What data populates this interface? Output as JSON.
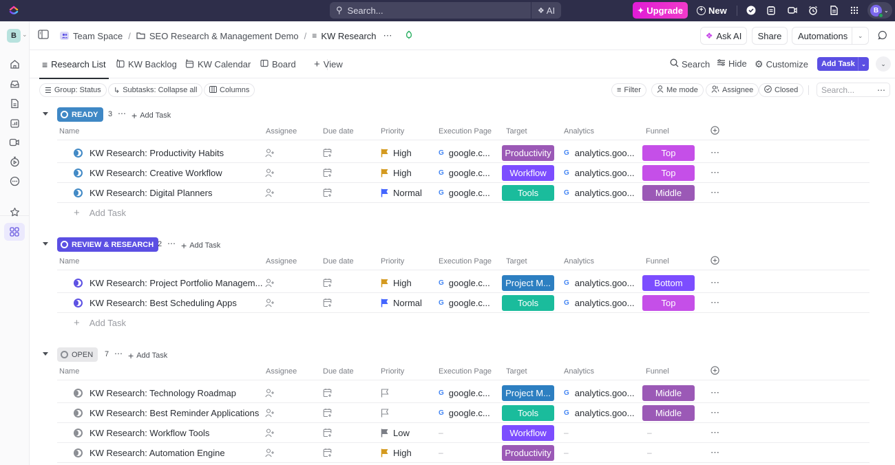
{
  "topbar": {
    "search_placeholder": "Search...",
    "ai_label": "AI",
    "upgrade_label": "Upgrade",
    "new_label": "New",
    "avatar_initial": "B"
  },
  "sidebar": {
    "workspace_initial": "B",
    "items": [
      "home",
      "inbox",
      "docs",
      "dashboards",
      "clips",
      "timesheets",
      "more",
      "favorites",
      "spaces"
    ]
  },
  "header": {
    "breadcrumbs": [
      "Team Space",
      "SEO Research & Management Demo",
      "KW Research"
    ],
    "ask_ai_label": "Ask AI",
    "share_label": "Share",
    "automations_label": "Automations"
  },
  "tabs": {
    "items": [
      "Research List",
      "KW Backlog",
      "KW Calendar",
      "Board"
    ],
    "add_view_label": "View",
    "search_label": "Search",
    "hide_label": "Hide",
    "customize_label": "Customize",
    "add_task_label": "Add Task"
  },
  "filters": {
    "group_label": "Group: Status",
    "subtasks_label": "Subtasks: Collapse all",
    "columns_label": "Columns",
    "filter_label": "Filter",
    "me_mode_label": "Me mode",
    "assignee_label": "Assignee",
    "closed_label": "Closed",
    "search_placeholder": "Search..."
  },
  "columns": [
    "Name",
    "Assignee",
    "Due date",
    "Priority",
    "Execution Page",
    "Target",
    "Analytics",
    "Funnel"
  ],
  "add_task_label": "Add Task",
  "colors": {
    "ready": "#3f88c5",
    "review": "#5b4fe3",
    "open": "#e8e8ea",
    "high": "#d49a1f",
    "normal": "#4466ff",
    "low": "#7c7f86",
    "productivity": "#9b59b6",
    "workflow": "#7c4dff",
    "tools": "#1abc9c",
    "project": "#2d7fc1",
    "top": "#c54fe8",
    "middle": "#9b59b6",
    "bottom": "#7c4dff"
  },
  "groups": [
    {
      "status": "READY",
      "count": "3",
      "tasks": [
        {
          "name": "KW Research: Productivity Habits",
          "priority": "High",
          "exec": "google.c...",
          "target": "Productivity",
          "analytics": "analytics.goo...",
          "funnel": "Top"
        },
        {
          "name": "KW Research: Creative Workflow",
          "priority": "High",
          "exec": "google.c...",
          "target": "Workflow",
          "analytics": "analytics.goo...",
          "funnel": "Top"
        },
        {
          "name": "KW Research: Digital Planners",
          "priority": "Normal",
          "exec": "google.c...",
          "target": "Tools",
          "analytics": "analytics.goo...",
          "funnel": "Middle"
        }
      ]
    },
    {
      "status": "REVIEW & RESEARCH",
      "count": "2",
      "tasks": [
        {
          "name": "KW Research: Project Portfolio Managem...",
          "priority": "High",
          "exec": "google.c...",
          "target": "Project M...",
          "analytics": "analytics.goo...",
          "funnel": "Bottom"
        },
        {
          "name": "KW Research: Best Scheduling Apps",
          "priority": "Normal",
          "exec": "google.c...",
          "target": "Tools",
          "analytics": "analytics.goo...",
          "funnel": "Top"
        }
      ]
    },
    {
      "status": "OPEN",
      "count": "7",
      "tasks": [
        {
          "name": "KW Research: Technology Roadmap",
          "priority": "",
          "exec": "google.c...",
          "target": "Project M...",
          "analytics": "analytics.goo...",
          "funnel": "Middle"
        },
        {
          "name": "KW Research: Best Reminder Applications",
          "priority": "",
          "exec": "google.c...",
          "target": "Tools",
          "analytics": "analytics.goo...",
          "funnel": "Middle"
        },
        {
          "name": "KW Research: Workflow Tools",
          "priority": "Low",
          "exec": "–",
          "target": "Workflow",
          "analytics": "–",
          "funnel": "–"
        },
        {
          "name": "KW Research: Automation Engine",
          "priority": "High",
          "exec": "–",
          "target": "Productivity",
          "analytics": "–",
          "funnel": "–"
        }
      ]
    }
  ]
}
